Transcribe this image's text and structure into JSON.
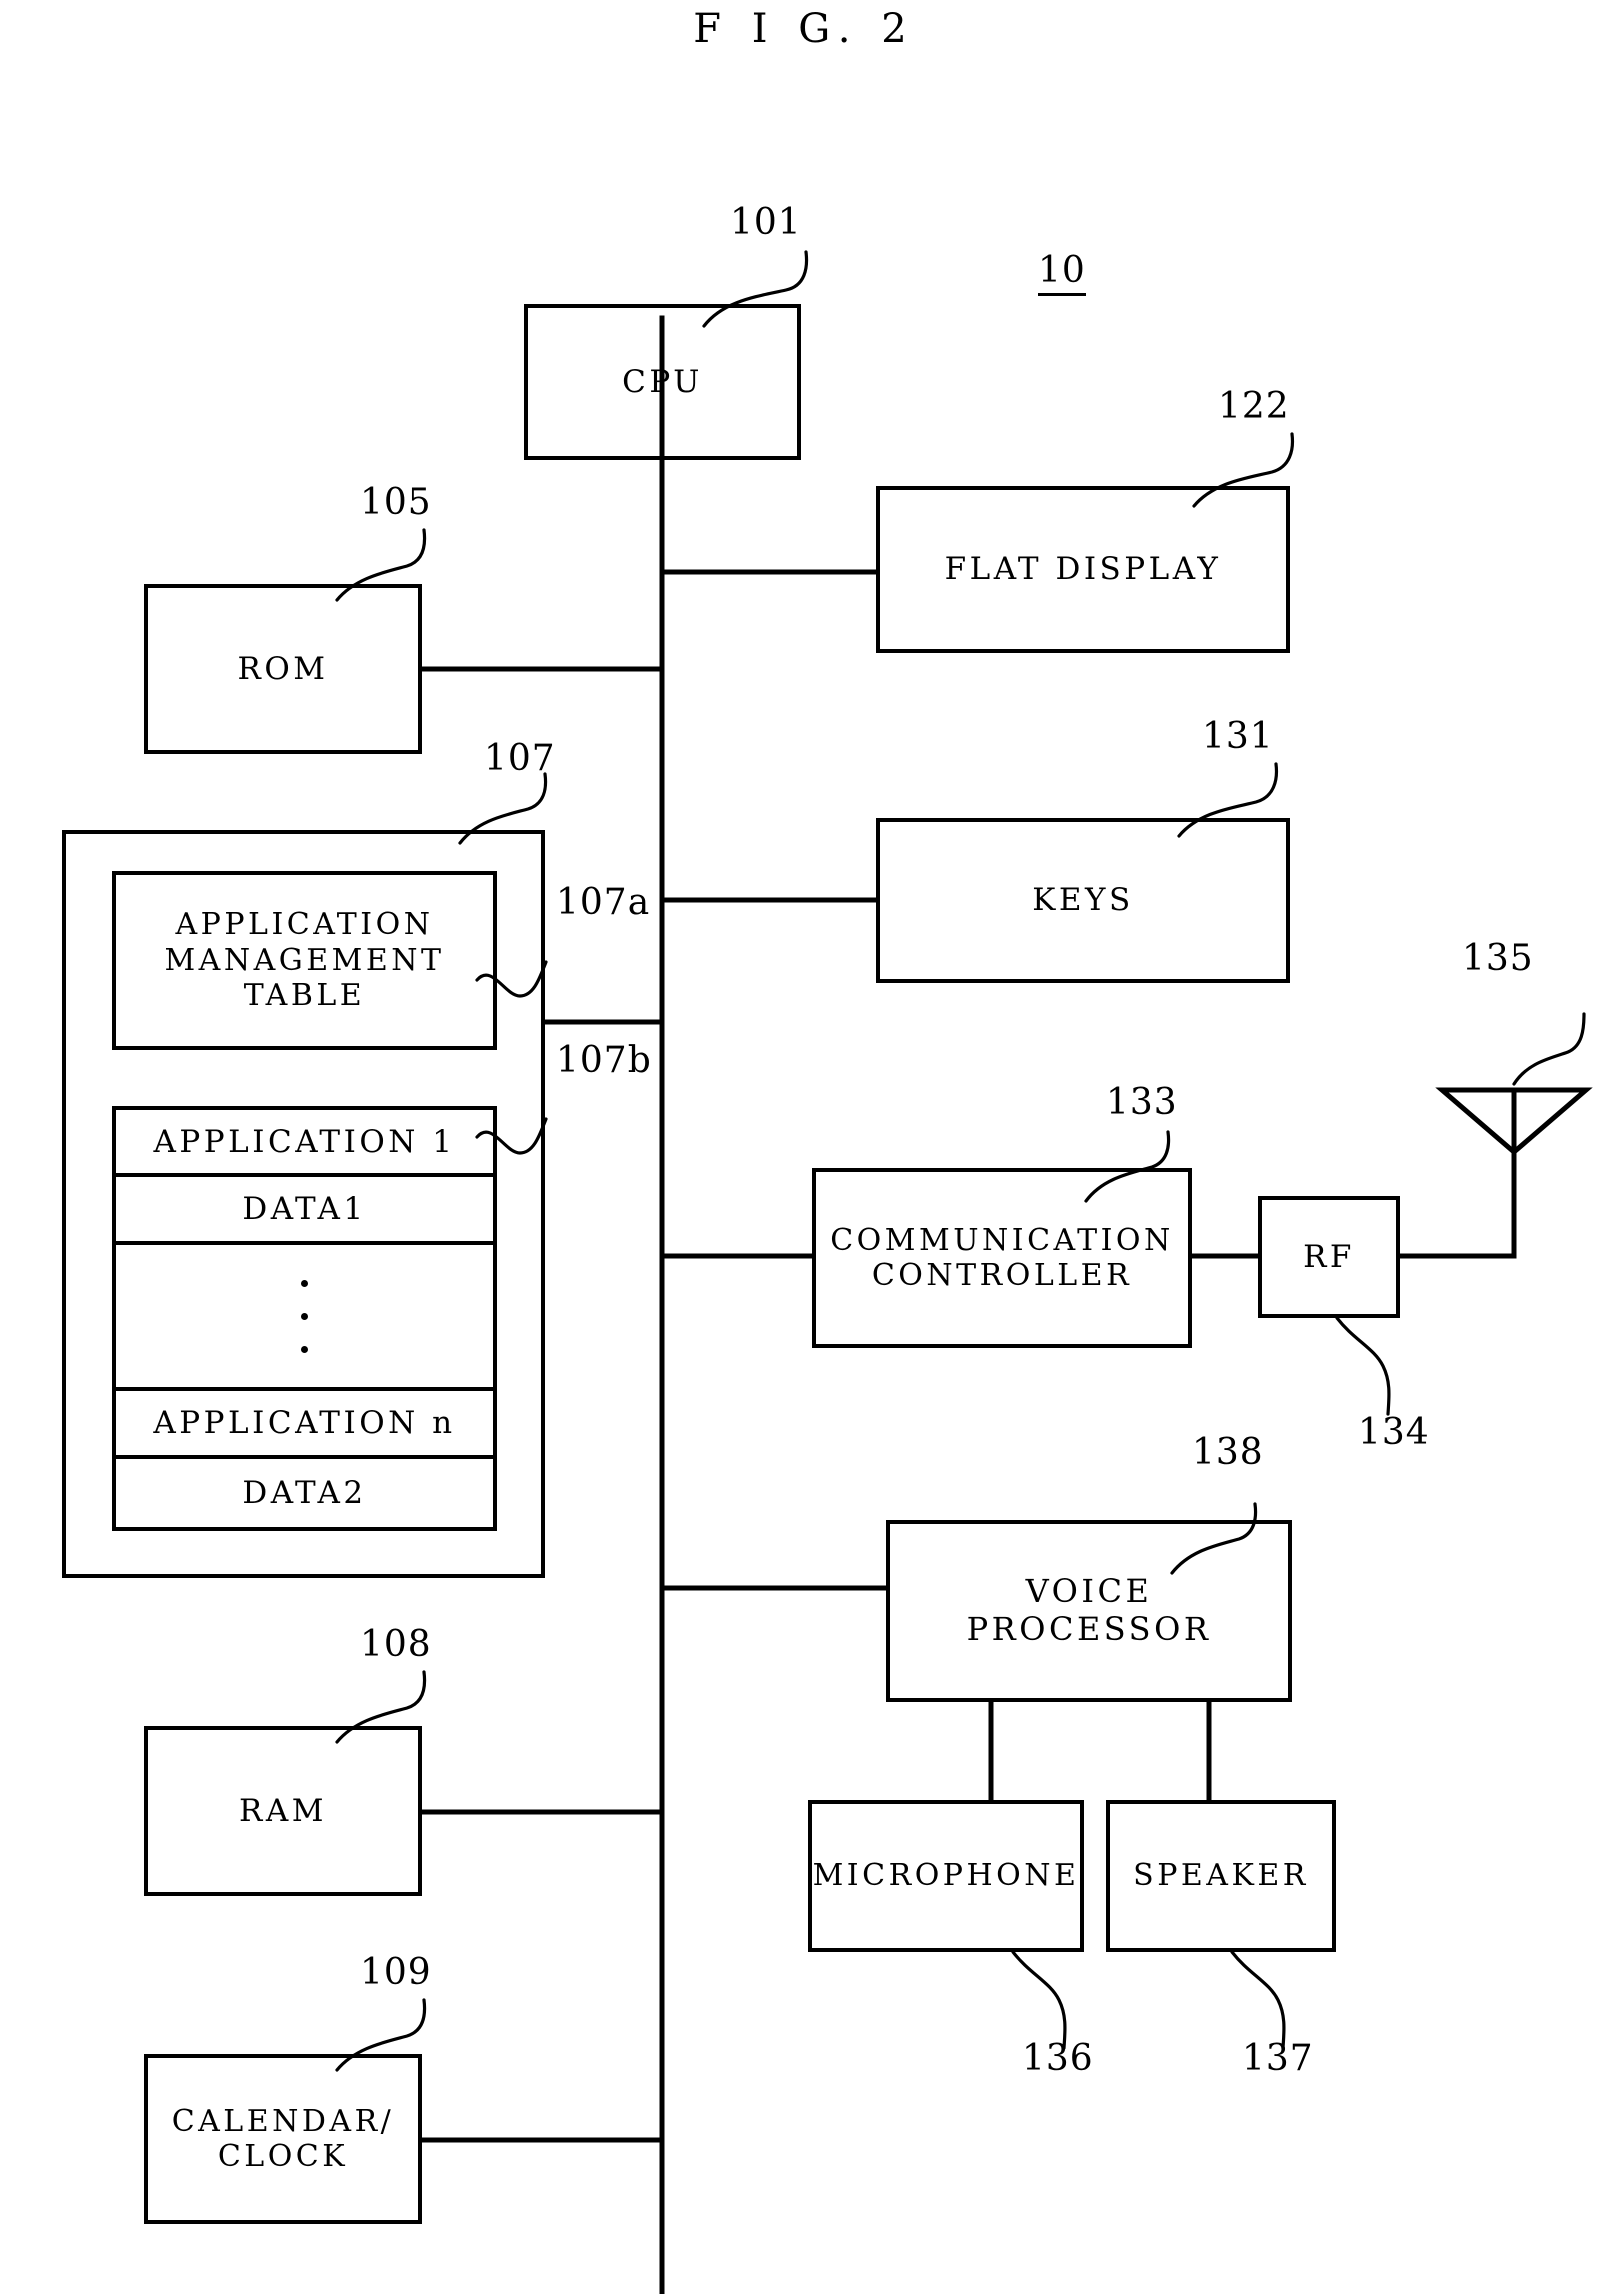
{
  "figure": {
    "title": "F I G.  2",
    "system_label": "10"
  },
  "blocks": {
    "cpu": {
      "label": "CPU",
      "ref": "101"
    },
    "rom": {
      "label": "ROM",
      "ref": "105"
    },
    "memory": {
      "ref": "107"
    },
    "app_table": {
      "label": "APPLICATION\nMANAGEMENT\nTABLE",
      "ref": "107a"
    },
    "app_list": {
      "ref": "107b"
    },
    "ram": {
      "label": "RAM",
      "ref": "108"
    },
    "calendar": {
      "label": "CALENDAR/\nCLOCK",
      "ref": "109"
    },
    "display": {
      "label": "FLAT DISPLAY",
      "ref": "122"
    },
    "keys": {
      "label": "KEYS",
      "ref": "131"
    },
    "comm": {
      "label": "COMMUNICATION\nCONTROLLER",
      "ref": "133"
    },
    "rf": {
      "label": "RF",
      "ref": "134"
    },
    "antenna": {
      "ref": "135"
    },
    "microphone": {
      "label": "MICROPHONE",
      "ref": "136"
    },
    "speaker": {
      "label": "SPEAKER",
      "ref": "137"
    },
    "voice": {
      "label": "VOICE\nPROCESSOR",
      "ref": "138"
    }
  },
  "app_list_rows": [
    {
      "label": "APPLICATION 1"
    },
    {
      "label": "DATA1"
    },
    {
      "label": ""
    },
    {
      "label": "APPLICATION n"
    },
    {
      "label": "DATA2"
    }
  ]
}
